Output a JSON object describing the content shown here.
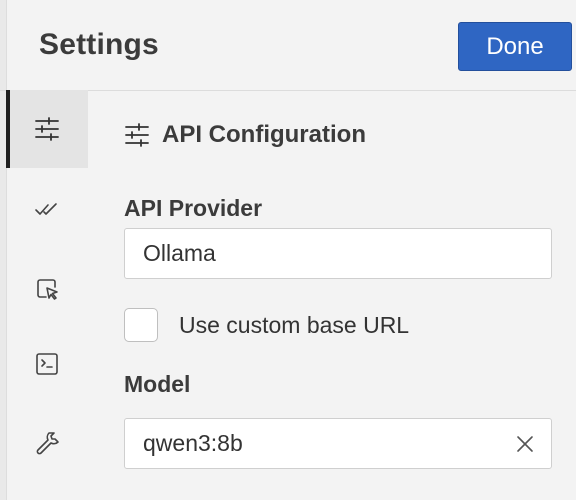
{
  "header": {
    "title": "Settings",
    "done_label": "Done"
  },
  "sidebar": {
    "tabs": [
      {
        "icon": "sliders-icon",
        "active": true
      },
      {
        "icon": "double-check-icon",
        "active": false
      },
      {
        "icon": "cursor-select-icon",
        "active": false
      },
      {
        "icon": "terminal-icon",
        "active": false
      },
      {
        "icon": "wrench-icon",
        "active": false
      }
    ]
  },
  "main": {
    "section_title": "API Configuration",
    "section_icon": "sliders-icon",
    "provider": {
      "label": "API Provider",
      "value": "Ollama"
    },
    "custom_base_url": {
      "label": "Use custom base URL",
      "checked": false
    },
    "model": {
      "label": "Model",
      "value": "qwen3:8b",
      "clear_icon": "close-icon"
    }
  },
  "colors": {
    "background": "#f3f3f3",
    "accent": "#2f66c3",
    "active_tab_bg": "#e4e4e4",
    "text": "#333333"
  }
}
